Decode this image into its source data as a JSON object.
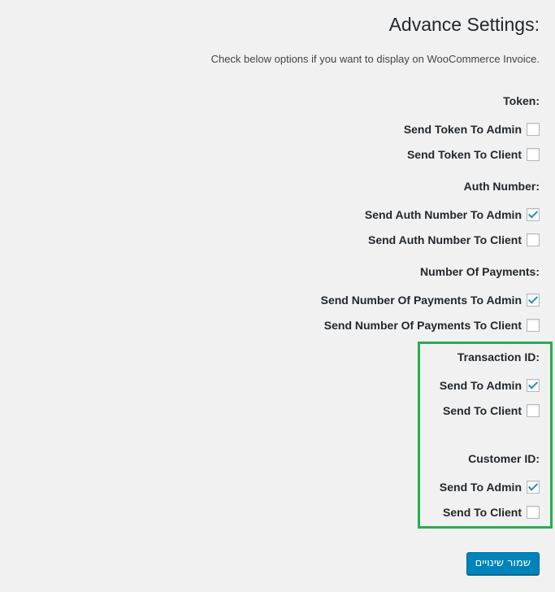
{
  "page": {
    "title": ":Advance Settings",
    "description": ".Check below options if you want to display on WooCommerce Invoice"
  },
  "sections": [
    {
      "title": ":Token",
      "options": [
        {
          "label": "Send Token To Admin",
          "checked": false
        },
        {
          "label": "Send Token To Client",
          "checked": false
        }
      ]
    },
    {
      "title": ":Auth Number",
      "options": [
        {
          "label": "Send Auth Number To Admin",
          "checked": true
        },
        {
          "label": "Send Auth Number To Client",
          "checked": false
        }
      ]
    },
    {
      "title": ":Number Of Payments",
      "options": [
        {
          "label": "Send Number Of Payments To Admin",
          "checked": true
        },
        {
          "label": "Send Number Of Payments To Client",
          "checked": false
        }
      ]
    },
    {
      "title": ":Transaction ID",
      "options": [
        {
          "label": "Send To Admin",
          "checked": true
        },
        {
          "label": "Send To Client",
          "checked": false
        }
      ]
    },
    {
      "title": ":Customer ID",
      "options": [
        {
          "label": "Send To Admin",
          "checked": true
        },
        {
          "label": "Send To Client",
          "checked": false
        }
      ]
    }
  ],
  "save_button": {
    "label": "שמור שינויים"
  },
  "colors": {
    "background": "#f1f1f1",
    "checkmark": "#1e8cbe",
    "highlight_border": "#22b14c",
    "primary_button": "#0085ba"
  }
}
